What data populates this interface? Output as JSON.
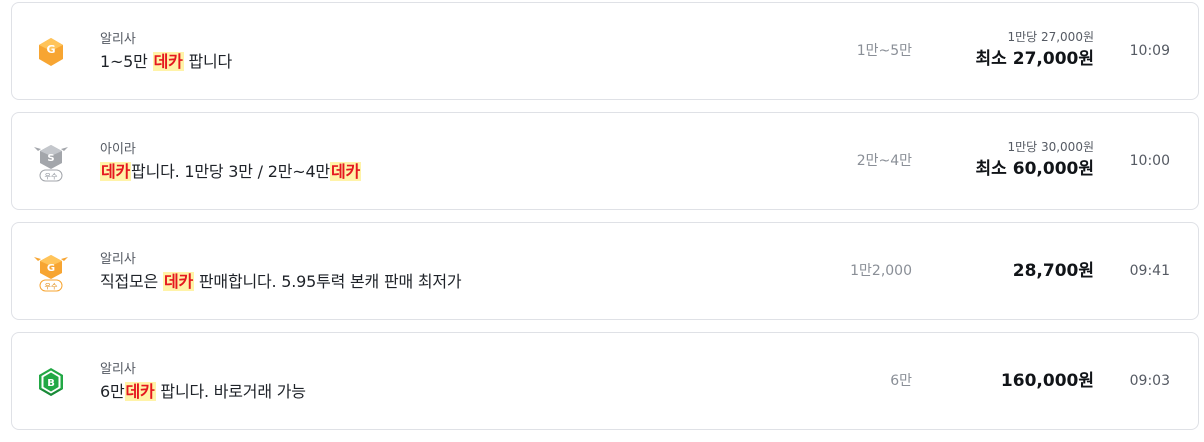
{
  "listings": [
    {
      "badge_icon": "g-grade-icon",
      "server": "알리사",
      "title_parts": [
        "1~5만 ",
        "데카",
        " 팝니다"
      ],
      "quantity": "1만~5만",
      "unit_price": "1만당 27,000원",
      "price": "최소 27,000원",
      "time": "10:09"
    },
    {
      "badge_icon": "s-grade-excellent-icon",
      "badge_tag": "우수",
      "server": "아이라",
      "title_parts": [
        "",
        "데카",
        "팝니다. 1만당 3만 / 2만~4만",
        "데카",
        ""
      ],
      "quantity": "2만~4만",
      "unit_price": "1만당 30,000원",
      "price": "최소 60,000원",
      "time": "10:00"
    },
    {
      "badge_icon": "g-grade-excellent-icon",
      "badge_tag": "우수",
      "server": "알리사",
      "title_parts": [
        "직접모은 ",
        "데카",
        " 판매합니다. 5.95투력 본캐 판매 최저가"
      ],
      "quantity": "1만2,000",
      "price": "28,700원",
      "time": "09:41"
    },
    {
      "badge_icon": "b-grade-icon",
      "server": "알리사",
      "title_parts": [
        "6만",
        "데카",
        " 팝니다. 바로거래 가능"
      ],
      "quantity": "6만",
      "price": "160,000원",
      "time": "09:03"
    }
  ],
  "colors": {
    "highlight_bg": "#fff3a8",
    "highlight_text": "#e5171f",
    "card_border": "#dfe1e6",
    "g_badge": "#f7a532",
    "s_badge": "#a3a6ab",
    "b_badge": "#22a845"
  }
}
